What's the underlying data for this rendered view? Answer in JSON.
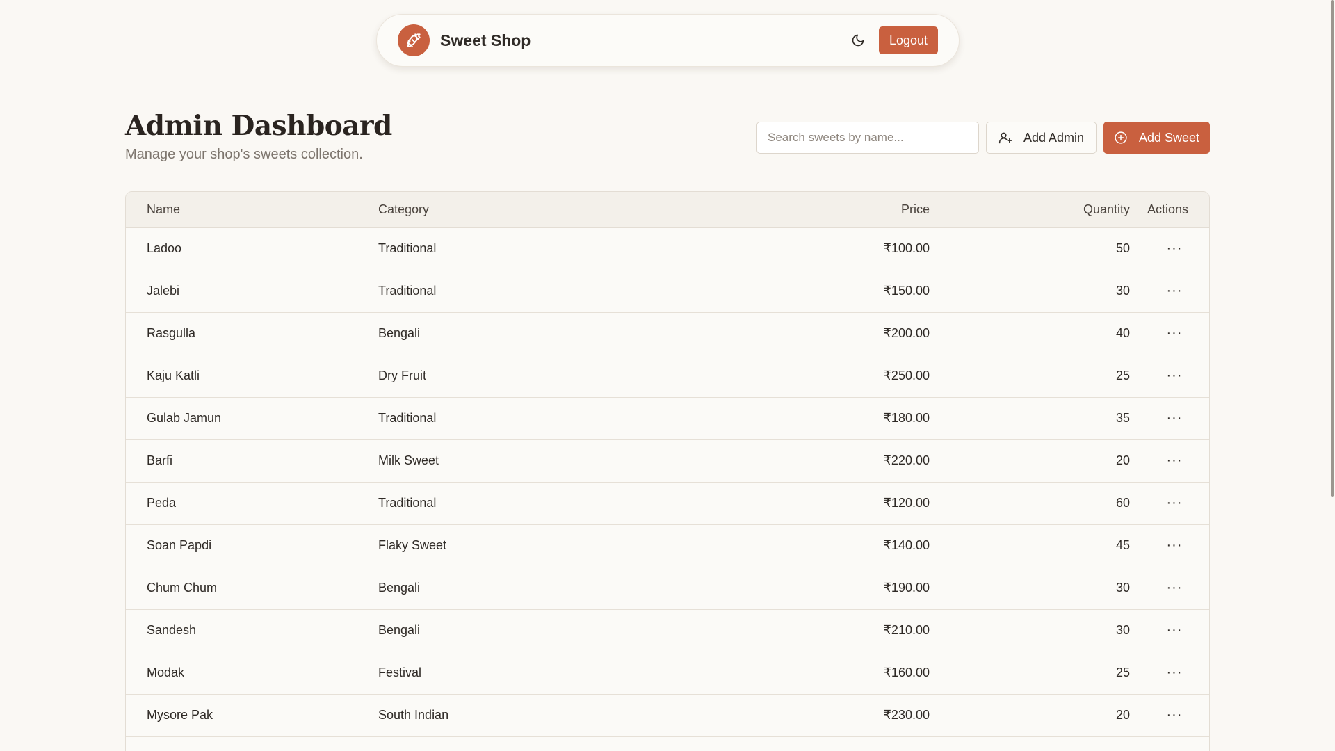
{
  "nav": {
    "brand": "Sweet Shop",
    "logout_label": "Logout"
  },
  "header": {
    "title": "Admin Dashboard",
    "subtitle": "Manage your shop's sweets collection."
  },
  "toolbar": {
    "search_placeholder": "Search sweets by name...",
    "add_admin_label": "Add Admin",
    "add_sweet_label": "Add Sweet"
  },
  "table": {
    "columns": [
      "Name",
      "Category",
      "Price",
      "Quantity",
      "Actions"
    ],
    "rows": [
      {
        "name": "Ladoo",
        "category": "Traditional",
        "price": "₹100.00",
        "quantity": "50"
      },
      {
        "name": "Jalebi",
        "category": "Traditional",
        "price": "₹150.00",
        "quantity": "30"
      },
      {
        "name": "Rasgulla",
        "category": "Bengali",
        "price": "₹200.00",
        "quantity": "40"
      },
      {
        "name": "Kaju Katli",
        "category": "Dry Fruit",
        "price": "₹250.00",
        "quantity": "25"
      },
      {
        "name": "Gulab Jamun",
        "category": "Traditional",
        "price": "₹180.00",
        "quantity": "35"
      },
      {
        "name": "Barfi",
        "category": "Milk Sweet",
        "price": "₹220.00",
        "quantity": "20"
      },
      {
        "name": "Peda",
        "category": "Traditional",
        "price": "₹120.00",
        "quantity": "60"
      },
      {
        "name": "Soan Papdi",
        "category": "Flaky Sweet",
        "price": "₹140.00",
        "quantity": "45"
      },
      {
        "name": "Chum Chum",
        "category": "Bengali",
        "price": "₹190.00",
        "quantity": "30"
      },
      {
        "name": "Sandesh",
        "category": "Bengali",
        "price": "₹210.00",
        "quantity": "30"
      },
      {
        "name": "Modak",
        "category": "Festival",
        "price": "₹160.00",
        "quantity": "25"
      },
      {
        "name": "Mysore Pak",
        "category": "South Indian",
        "price": "₹230.00",
        "quantity": "20"
      },
      {
        "name": "",
        "category": "",
        "price": "",
        "quantity": ""
      }
    ],
    "row_menu_glyph": "···"
  },
  "icons": {
    "logo": "candy-icon",
    "theme": "moon-icon",
    "add_admin": "user-plus-icon",
    "add_sweet": "plus-circle-icon",
    "row_action": "more-horizontal-icon"
  },
  "colors": {
    "accent": "#c9603f",
    "background": "#faf8f4",
    "text": "#2f2a26",
    "muted": "#7d756d"
  }
}
